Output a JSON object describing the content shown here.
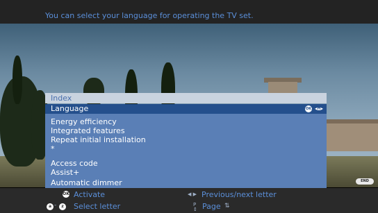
{
  "hint": {
    "text": "You can select your language for operating the TV set."
  },
  "menu": {
    "header": "Index",
    "selected_item": "Language",
    "ok_key_label": "OK",
    "items": [
      "Energy efficiency",
      "Integrated features",
      "Repeat initial installation",
      "*",
      "Access code",
      "Assist+",
      "Automatic dimmer"
    ]
  },
  "end_button": {
    "label": "END"
  },
  "legend": {
    "ok_key_label": "OK",
    "activate": "Activate",
    "key_a": "a",
    "key_z": "z",
    "key_separator": "-",
    "select_letter": "Select letter",
    "prev_next_letter": "Previous/next letter",
    "page": "Page"
  },
  "icons": {
    "ok": "ok-button-icon",
    "nav": "four-way-arrows-icon",
    "prev_next": "left-right-arrows-icon",
    "page": "page-up-down-icon",
    "updown": "up-down-arrows-icon"
  },
  "colors": {
    "hint_text": "#5b8fd9",
    "menu_header_bg": "#c9d3df",
    "menu_bg": "#5a7fb6",
    "menu_selected_bg": "#244f8c",
    "bar_bg": "#2a2a2a"
  }
}
